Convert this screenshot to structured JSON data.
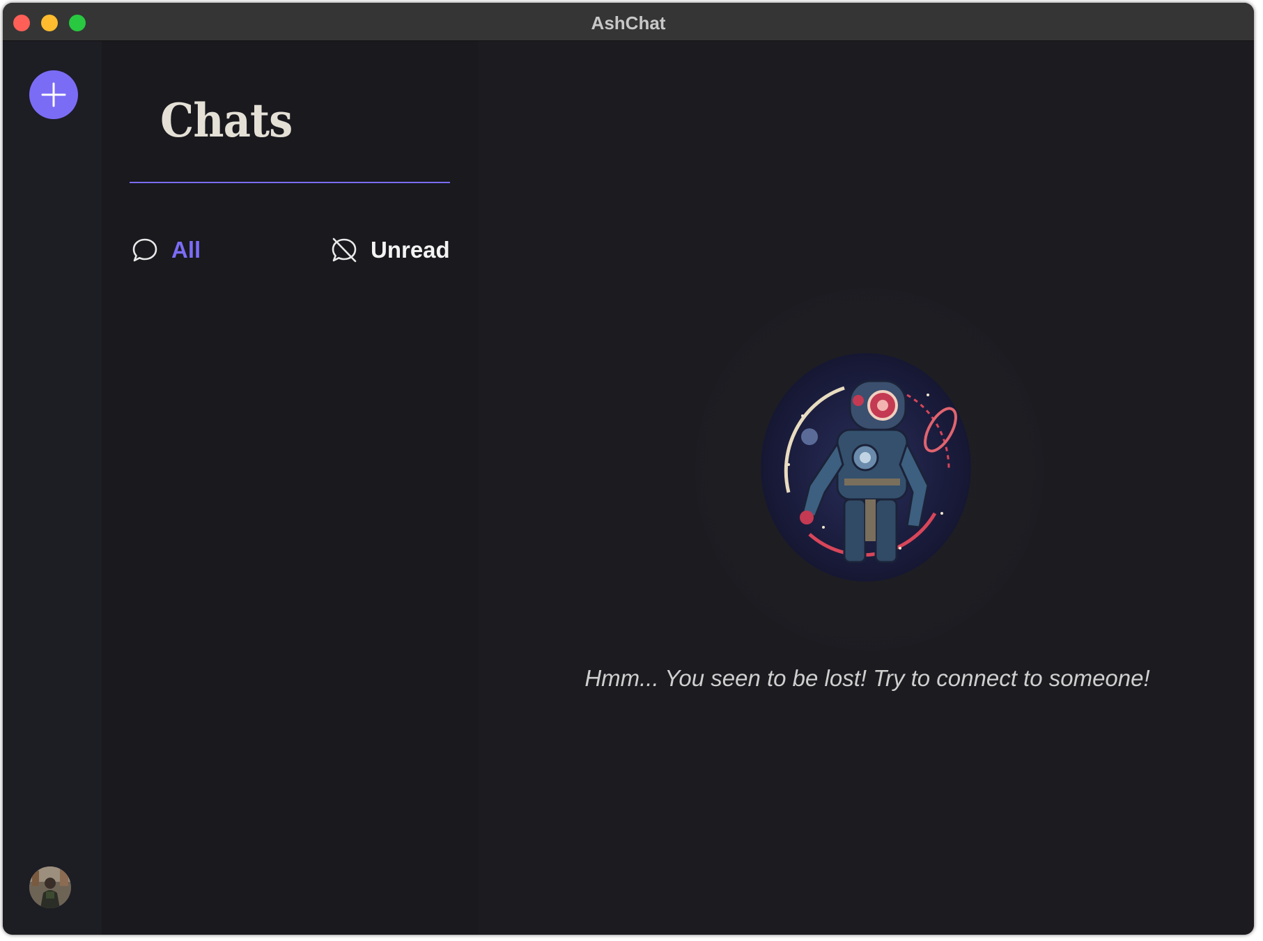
{
  "window": {
    "title": "AshChat"
  },
  "rail": {
    "new_chat_icon": "plus-icon",
    "avatar_icon": "user-avatar"
  },
  "panel": {
    "title": "Chats",
    "filters": [
      {
        "label": "All",
        "icon": "chat-bubble-icon",
        "active": true
      },
      {
        "label": "Unread",
        "icon": "chat-bubble-off-icon",
        "active": false
      }
    ]
  },
  "main": {
    "illustration": "robot-astronaut-illustration",
    "empty_message": "Hmm... You seen to be lost! Try to connect to someone!"
  },
  "colors": {
    "accent": "#7b6cf6",
    "background": "#1b1b20",
    "panel": "#19191e",
    "rail": "#1d1d24"
  }
}
